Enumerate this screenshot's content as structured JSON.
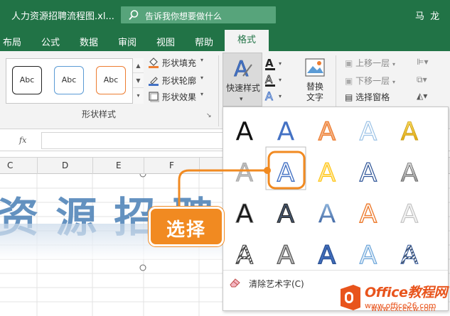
{
  "titlebar": {
    "doc_title": "人力资源招聘流程图.xl...",
    "tell_me": "告诉我你想要做什么",
    "user": "马 龙"
  },
  "tabs": {
    "items": [
      "布局",
      "公式",
      "数据",
      "审阅",
      "视图",
      "帮助"
    ],
    "active": "格式"
  },
  "shape_styles": {
    "thumbs": [
      "Abc",
      "Abc",
      "Abc"
    ],
    "fill": "形状填充",
    "outline": "形状轮廓",
    "effects": "形状效果",
    "group_label": "形状样式"
  },
  "wordart": {
    "quick_styles": "快速样式",
    "alt_text": "替换\n文字"
  },
  "arrange": {
    "bring_forward": "上移一层",
    "send_backward": "下移一层",
    "selection_pane": "选择窗格"
  },
  "formula_bar": {
    "fx": "fx"
  },
  "columns": [
    "C",
    "D",
    "E",
    "F"
  ],
  "sheet_text": "资 源 招 聘",
  "gallery": {
    "glyph": "A",
    "clear": "清除艺术字(C)"
  },
  "callout": "选择",
  "watermark": {
    "brand": "Office教程网",
    "url": "www.office26.com",
    "url2": "www.excelcw.com"
  },
  "colors": {
    "excel_green": "#217346",
    "accent_orange": "#f18a21",
    "selection_blue": "#4472c4"
  }
}
